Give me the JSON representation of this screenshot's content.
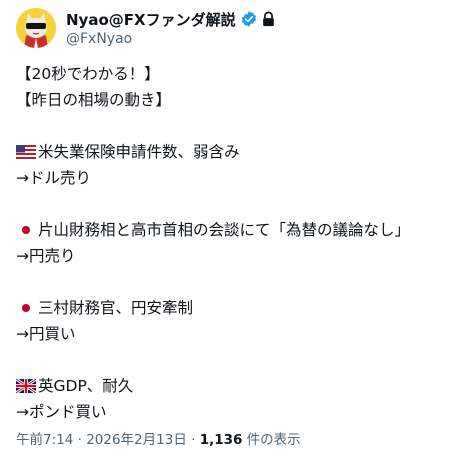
{
  "author": {
    "display_name": "Nyao@FXファンダ解説",
    "handle": "@FxNyao",
    "avatar_icon": "cat-with-sunglasses-avatar",
    "verified_icon": "verified-badge-icon",
    "lock_icon": "lock-icon",
    "verified_color": "#1d9bf0"
  },
  "post": {
    "line1": "【20秒でわかる！】",
    "line2": "【昨日の相場の動き】",
    "item1_flag": "us-flag-icon",
    "item1_text": "米失業保険申請件数、弱含み",
    "item1_result": "→ドル売り",
    "item2_flag": "japan-flag-icon",
    "item2_text": "片山財務相と高市首相の会談にて「為替の議論なし」",
    "item2_result": "→円売り",
    "item3_flag": "japan-flag-icon",
    "item3_text": "三村財務官、円安牽制",
    "item3_result": "→円買い",
    "item4_flag": "uk-flag-icon",
    "item4_text": "英GDP、耐久",
    "item4_result": "→ポンド買い"
  },
  "meta": {
    "time_date": "午前7:14 · 2026年2月13日 · ",
    "views_count": "1,136",
    "views_label": " 件の表示"
  }
}
